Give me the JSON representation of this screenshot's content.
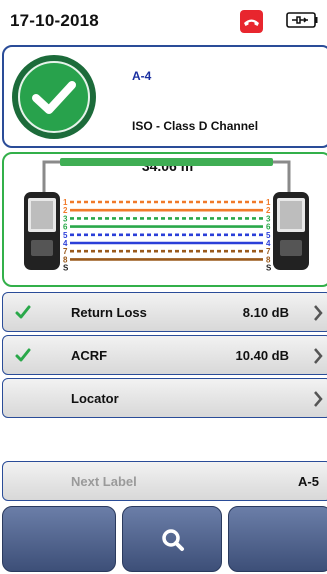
{
  "status_bar": {
    "date": "17-10-2018",
    "icons": [
      "phone-hangup-icon",
      "battery-icon"
    ]
  },
  "result": {
    "status_icon": "check-mark-icon",
    "label": "A-4",
    "standard": "ISO - Class D Channel"
  },
  "wiremap": {
    "length": "34.06 m",
    "left_pins": [
      "1",
      "2",
      "3",
      "6",
      "5",
      "4",
      "7",
      "8",
      "S"
    ],
    "right_pins": [
      "1",
      "2",
      "3",
      "6",
      "5",
      "4",
      "7",
      "8",
      "S"
    ],
    "pair_colors": {
      "orange": "#f07a2a",
      "green": "#2aa84a",
      "blue": "#2b3fd8",
      "brown": "#9a5a1c"
    }
  },
  "measurements": [
    {
      "name": "Return Loss",
      "value": "8.10 dB",
      "status": "pass"
    },
    {
      "name": "ACRF",
      "value": "10.40 dB",
      "status": "pass"
    },
    {
      "name": "Locator",
      "value": "",
      "status": "none"
    }
  ],
  "next_label": {
    "name": "Next Label",
    "value": "A-5"
  },
  "softkeys": [
    "blank",
    "search-icon",
    "blank"
  ],
  "colors": {
    "accent_blue": "#2a4c98",
    "pass_green": "#28a24c",
    "alert_red": "#e8262e"
  }
}
